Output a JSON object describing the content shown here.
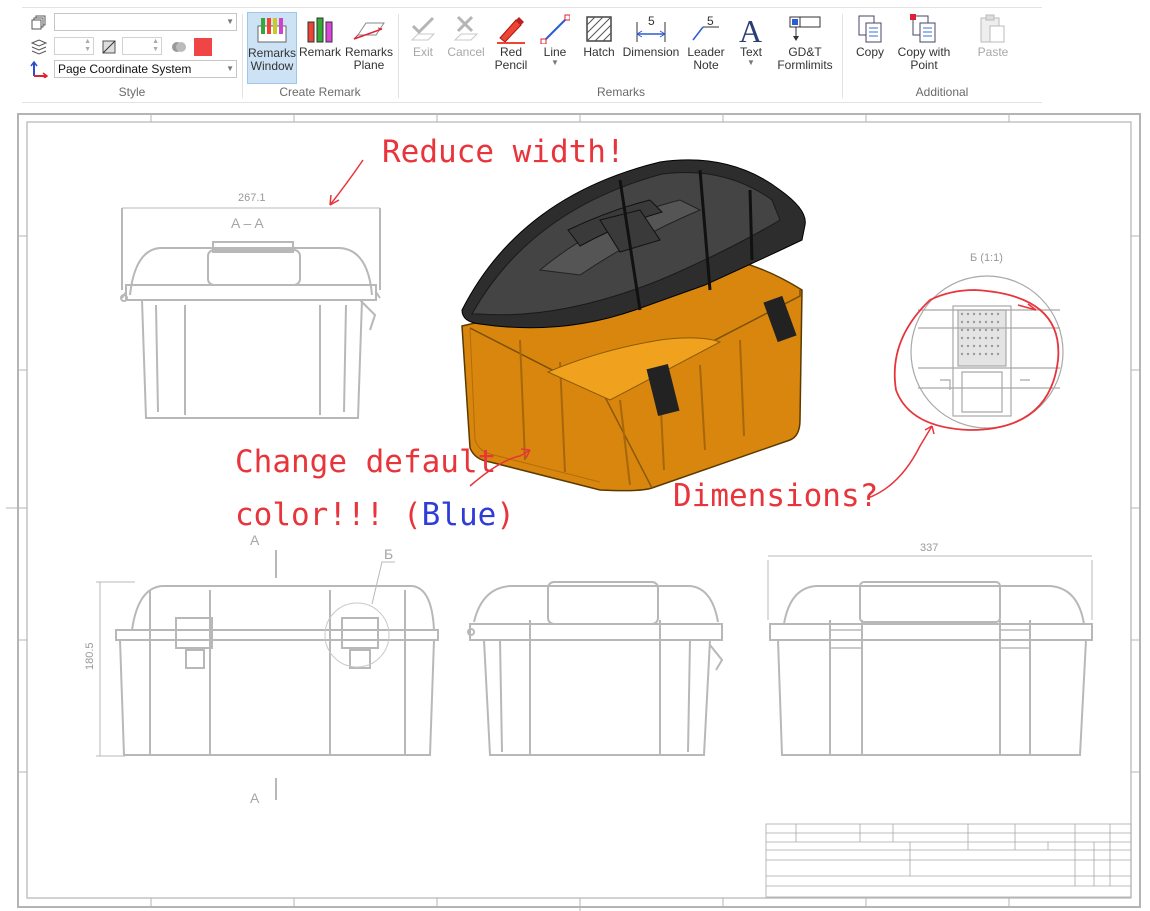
{
  "ribbon": {
    "style": {
      "group_label": "Style",
      "layer_combo_value": "",
      "coordinate_system": "Page Coordinate System",
      "color_swatch": "#f04545"
    },
    "create_remark": {
      "group_label": "Create Remark",
      "remarks_window": "Remarks\nWindow",
      "remark": "Remark",
      "remarks_plane": "Remarks\nPlane"
    },
    "remarks": {
      "group_label": "Remarks",
      "exit": "Exit",
      "cancel": "Cancel",
      "red_pencil": "Red\nPencil",
      "line": "Line",
      "hatch": "Hatch",
      "dimension": "Dimension",
      "leader_note": "Leader\nNote",
      "text": "Text",
      "gdt": "GD&T\nFormlimits",
      "dim_icon_num": "5",
      "leader_icon_num": "5"
    },
    "additional": {
      "group_label": "Additional",
      "copy": "Copy",
      "copy_with_point": "Copy with\nPoint",
      "paste": "Paste"
    }
  },
  "drawing": {
    "notes": {
      "reduce_width": "Reduce width!",
      "change_color_1": "Change default",
      "change_color_2": "color!!! (",
      "change_color_blue": "Blue",
      "change_color_3": ")",
      "dimensions": "Dimensions?"
    },
    "dimensions": {
      "width_top": "267.1",
      "width_right": "337",
      "height_left": "180.5"
    },
    "labels": {
      "section_title": "A – A",
      "section_mark_top": "A",
      "section_mark_bottom": "A",
      "detail_mark": "Б",
      "detail_title": "Б (1:1)"
    },
    "colors": {
      "note_red": "#e8343b",
      "note_blue": "#2f3dd8",
      "line_gray": "#b4b4b4",
      "box_orange": "#d8860e",
      "lid_black": "#2d2d2d"
    }
  }
}
